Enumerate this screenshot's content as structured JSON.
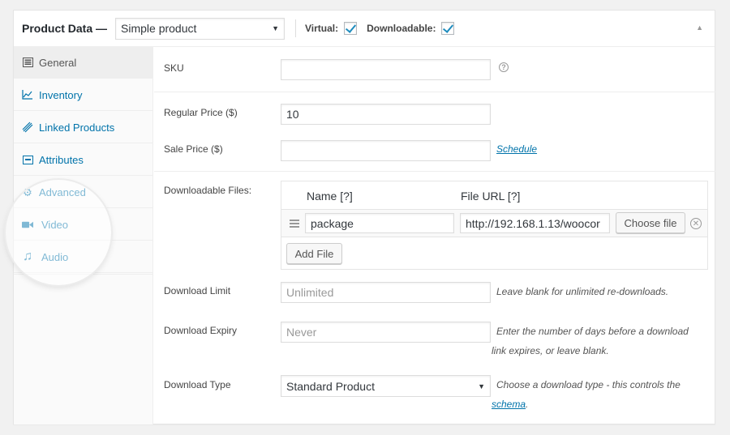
{
  "header": {
    "title": "Product Data —",
    "product_type": "Simple product",
    "virtual_label": "Virtual:",
    "virtual_checked": true,
    "downloadable_label": "Downloadable:",
    "downloadable_checked": true,
    "collapse_icon": "triangle-up-icon"
  },
  "tabs": [
    {
      "label": "General",
      "icon": "general-icon",
      "active": true
    },
    {
      "label": "Inventory",
      "icon": "inventory-icon",
      "active": false
    },
    {
      "label": "Linked Products",
      "icon": "link-icon",
      "active": false
    },
    {
      "label": "Attributes",
      "icon": "attributes-icon",
      "active": false
    },
    {
      "label": "Advanced",
      "icon": "gear-icon",
      "active": false
    },
    {
      "label": "Video",
      "icon": "video-camera-icon",
      "active": false
    },
    {
      "label": "Audio",
      "icon": "music-note-icon",
      "active": false
    }
  ],
  "fields": {
    "sku": {
      "label": "SKU",
      "value": ""
    },
    "regular_price": {
      "label": "Regular Price ($)",
      "value": "10"
    },
    "sale_price": {
      "label": "Sale Price ($)",
      "value": "",
      "schedule_link": "Schedule"
    },
    "downloadable_files": {
      "label": "Downloadable Files:",
      "col_name": "Name [?]",
      "col_url": "File URL [?]",
      "rows": [
        {
          "name": "package",
          "url": "http://192.168.1.13/woocor",
          "choose_label": "Choose file"
        }
      ],
      "add_file_label": "Add File"
    },
    "download_limit": {
      "label": "Download Limit",
      "placeholder": "Unlimited",
      "desc": "Leave blank for unlimited re-downloads."
    },
    "download_expiry": {
      "label": "Download Expiry",
      "placeholder": "Never",
      "desc_line1": "Enter the number of days before a download",
      "desc_line2": "link expires, or leave blank."
    },
    "download_type": {
      "label": "Download Type",
      "value": "Standard Product",
      "desc_line1": "Choose a download type - this controls the",
      "desc_link": "schema",
      "desc_end": "."
    }
  }
}
